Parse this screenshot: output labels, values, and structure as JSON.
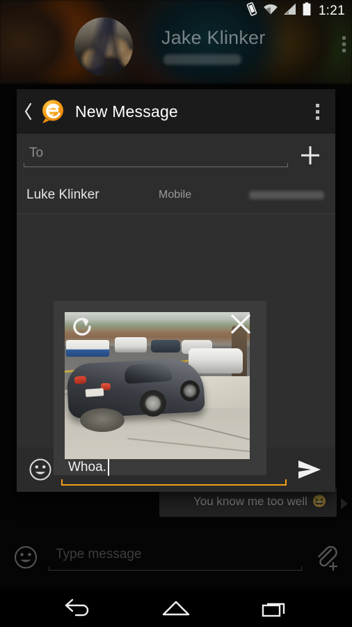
{
  "status_bar": {
    "time": "1:21",
    "icons": [
      "vibrate-icon",
      "wifi-icon",
      "cellular-signal-icon",
      "battery-icon"
    ]
  },
  "background_app": {
    "contact_name": "Jake Klinker",
    "contact_number": "",
    "avatar": "contact-avatar-photo",
    "overflow_label": "",
    "last_message": {
      "text": "You know me too well",
      "emoji": "😆"
    },
    "compose": {
      "placeholder": "Type message",
      "value": "",
      "emoji_button": "emoji-icon",
      "attach_button": "attach-paperclip-icon"
    }
  },
  "dialog": {
    "title": "New Message",
    "back_label": "‹",
    "app_logo": "evolve-sms-logo",
    "overflow_label": "overflow-menu-icon",
    "recipient_field": {
      "placeholder": "To",
      "value": ""
    },
    "add_contact_button": "add-contact-plus-icon",
    "contact_suggestion": {
      "name": "Luke Klinker",
      "type": "Mobile",
      "number": ""
    },
    "attachment": {
      "preview": "ferrari-street-photo",
      "rotate_button": "rotate-icon",
      "close_button": "close-icon"
    },
    "compose": {
      "placeholder": "",
      "value": "Whoa.",
      "emoji_button": "emoji-icon",
      "send_button": "send-icon",
      "accent_color": "#f0a018"
    }
  },
  "nav_bar": {
    "back": "back-icon",
    "home": "home-icon",
    "recents": "recents-icon"
  },
  "colors": {
    "accent": "#f0a018",
    "dialog_bg": "#2f2f2f",
    "dialog_header_bg": "#1b1b1b",
    "screen_bg": "#0a0a0a"
  }
}
